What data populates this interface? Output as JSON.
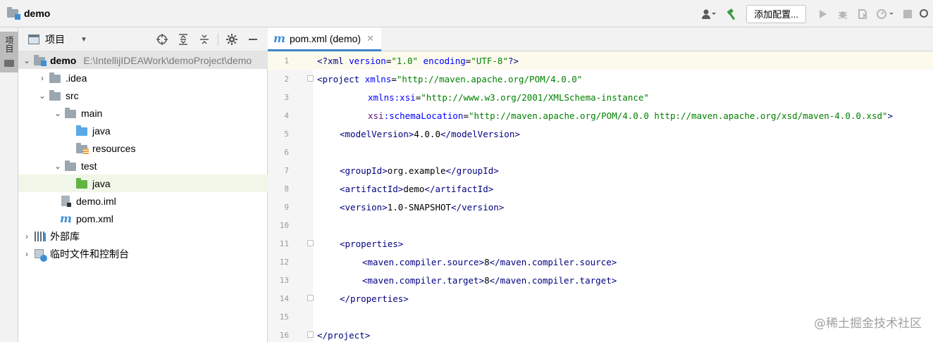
{
  "topbar": {
    "project_name": "demo",
    "run_config_label": "添加配置..."
  },
  "strip": {
    "project_tab_label": "项目"
  },
  "project_panel": {
    "title": "项目",
    "tree": [
      {
        "label": "demo",
        "path": "E:\\IntellijIDEAWork\\demoProject\\demo",
        "icon": "module-folder-icon",
        "arrow": "expanded"
      },
      {
        "label": ".idea",
        "icon": "folder-icon",
        "arrow": "collapsed"
      },
      {
        "label": "src",
        "icon": "folder-icon",
        "arrow": "expanded"
      },
      {
        "label": "main",
        "icon": "folder-icon",
        "arrow": "expanded"
      },
      {
        "label": "java",
        "icon": "source-folder-icon"
      },
      {
        "label": "resources",
        "icon": "resources-folder-icon"
      },
      {
        "label": "test",
        "icon": "folder-icon",
        "arrow": "expanded"
      },
      {
        "label": "java",
        "icon": "test-source-folder-icon"
      },
      {
        "label": "demo.iml",
        "icon": "iml-file-icon"
      },
      {
        "label": "pom.xml",
        "icon": "maven-file-icon"
      },
      {
        "label": "外部库",
        "icon": "library-icon",
        "arrow": "collapsed"
      },
      {
        "label": "临时文件和控制台",
        "icon": "scratches-icon",
        "arrow": "collapsed"
      }
    ]
  },
  "editor": {
    "tab_label": "pom.xml (demo)",
    "lines": [
      {
        "n": "1"
      },
      {
        "n": "2"
      },
      {
        "n": "3"
      },
      {
        "n": "4"
      },
      {
        "n": "5"
      },
      {
        "n": "6"
      },
      {
        "n": "7"
      },
      {
        "n": "8"
      },
      {
        "n": "9"
      },
      {
        "n": "10"
      },
      {
        "n": "11"
      },
      {
        "n": "12"
      },
      {
        "n": "13"
      },
      {
        "n": "14"
      },
      {
        "n": "15"
      },
      {
        "n": "16"
      }
    ],
    "code": {
      "l1_a": "<?xml ",
      "l1_b": "version",
      "l1_c": "=",
      "l1_d": "\"1.0\"",
      "l1_e": " ",
      "l1_f": "encoding",
      "l1_g": "=",
      "l1_h": "\"UTF-8\"",
      "l1_i": "?>",
      "l2_a": "<project ",
      "l2_b": "xmlns",
      "l2_c": "=",
      "l2_d": "\"http://maven.apache.org/POM/4.0.0\"",
      "l3_a": "xmlns",
      "l3_b": ":xsi",
      "l3_c": "=",
      "l3_d": "\"http://www.w3.org/2001/XMLSchema-instance\"",
      "l4_a": "xsi",
      "l4_b": ":schemaLocation",
      "l4_c": "=",
      "l4_d": "\"http://maven.apache.org/POM/4.0.0 http://maven.apache.org/xsd/maven-4.0.0.xsd\"",
      "l4_e": ">",
      "l5_a": "<modelVersion>",
      "l5_b": "4.0.0",
      "l5_c": "</modelVersion>",
      "l7_a": "<groupId>",
      "l7_b": "org.example",
      "l7_c": "</groupId>",
      "l8_a": "<artifactId>",
      "l8_b": "demo",
      "l8_c": "</artifactId>",
      "l9_a": "<version>",
      "l9_b": "1.0-SNAPSHOT",
      "l9_c": "</version>",
      "l11_a": "<properties>",
      "l12_a": "<maven.compiler.source>",
      "l12_b": "8",
      "l12_c": "</maven.compiler.source>",
      "l13_a": "<maven.compiler.target>",
      "l13_b": "8",
      "l13_c": "</maven.compiler.target>",
      "l14_a": "</properties>",
      "l16_a": "</project>"
    }
  },
  "watermark": "@稀土掘金技术社区"
}
